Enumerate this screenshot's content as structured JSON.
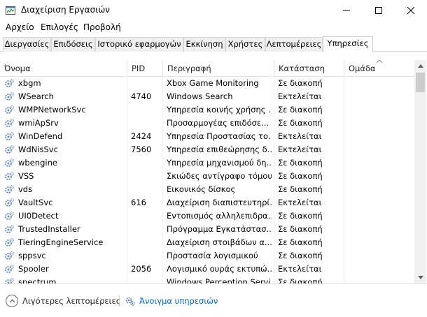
{
  "window": {
    "title": "Διαχείριση Εργασιών"
  },
  "menu": [
    "Αρχείο",
    "Επιλογές",
    "Προβολή"
  ],
  "tabs": [
    {
      "label": "Διεργασίες",
      "active": false
    },
    {
      "label": "Επιδόσεις",
      "active": false
    },
    {
      "label": "Ιστορικό εφαρμογών",
      "active": false
    },
    {
      "label": "Εκκίνηση",
      "active": false
    },
    {
      "label": "Χρήστες",
      "active": false
    },
    {
      "label": "Λεπτομέρειες",
      "active": false
    },
    {
      "label": "Υπηρεσίες",
      "active": true
    }
  ],
  "table": {
    "columns": {
      "name": "Όνομα",
      "pid": "PID",
      "description": "Περιγραφή",
      "status": "Κατάσταση",
      "group": "Ομάδα"
    },
    "rows": [
      {
        "name": "xbgm",
        "pid": "",
        "description": "Xbox Game Monitoring",
        "status": "Σε διακοπή",
        "group": ""
      },
      {
        "name": "WSearch",
        "pid": "4740",
        "description": "Windows Search",
        "status": "Εκτελείται",
        "group": ""
      },
      {
        "name": "WMPNetworkSvc",
        "pid": "",
        "description": "Υπηρεσία κοινής χρήσης ...",
        "status": "Σε διακοπή",
        "group": ""
      },
      {
        "name": "wmiApSrv",
        "pid": "",
        "description": "Προσαρμογέας επιδόσε...",
        "status": "Σε διακοπή",
        "group": ""
      },
      {
        "name": "WinDefend",
        "pid": "2424",
        "description": "Υπηρεσία Προστασίας το...",
        "status": "Εκτελείται",
        "group": ""
      },
      {
        "name": "WdNisSvc",
        "pid": "7560",
        "description": "Υπηρεσία επιθεώρησης δ...",
        "status": "Εκτελείται",
        "group": ""
      },
      {
        "name": "wbengine",
        "pid": "",
        "description": "Υπηρεσία μηχανισμού δη...",
        "status": "Σε διακοπή",
        "group": ""
      },
      {
        "name": "VSS",
        "pid": "",
        "description": "Σκιώδες αντίγραφο τόμου",
        "status": "Σε διακοπή",
        "group": ""
      },
      {
        "name": "vds",
        "pid": "",
        "description": "Εικονικός δίσκος",
        "status": "Σε διακοπή",
        "group": ""
      },
      {
        "name": "VaultSvc",
        "pid": "616",
        "description": "Διαχείριση διαπιστευτηρί...",
        "status": "Εκτελείται",
        "group": ""
      },
      {
        "name": "UI0Detect",
        "pid": "",
        "description": "Εντοπισμός αλληλεπιδρα...",
        "status": "Σε διακοπή",
        "group": ""
      },
      {
        "name": "TrustedInstaller",
        "pid": "",
        "description": "Πρόγραμμα Εγκατάστασ...",
        "status": "Σε διακοπή",
        "group": ""
      },
      {
        "name": "TieringEngineService",
        "pid": "",
        "description": "Διαχείριση στοιβάδων α...",
        "status": "Σε διακοπή",
        "group": ""
      },
      {
        "name": "sppsvc",
        "pid": "",
        "description": "Προστασία λογισμικού",
        "status": "Σε διακοπή",
        "group": ""
      },
      {
        "name": "Spooler",
        "pid": "2056",
        "description": "Λογισμικό ουράς εκτυπώ...",
        "status": "Εκτελείται",
        "group": ""
      },
      {
        "name": "spectrum",
        "pid": "",
        "description": "Windows Perception Servi...",
        "status": "Σε διακοπή",
        "group": ""
      }
    ]
  },
  "footer": {
    "fewer_details": "Λιγότερες λεπτομέρειες",
    "open_services": "Άνοιγμα υπηρεσιών"
  },
  "colors": {
    "link": "#0066cc",
    "tab_inactive": "#f0f0f0",
    "border": "#d9d9d9"
  }
}
